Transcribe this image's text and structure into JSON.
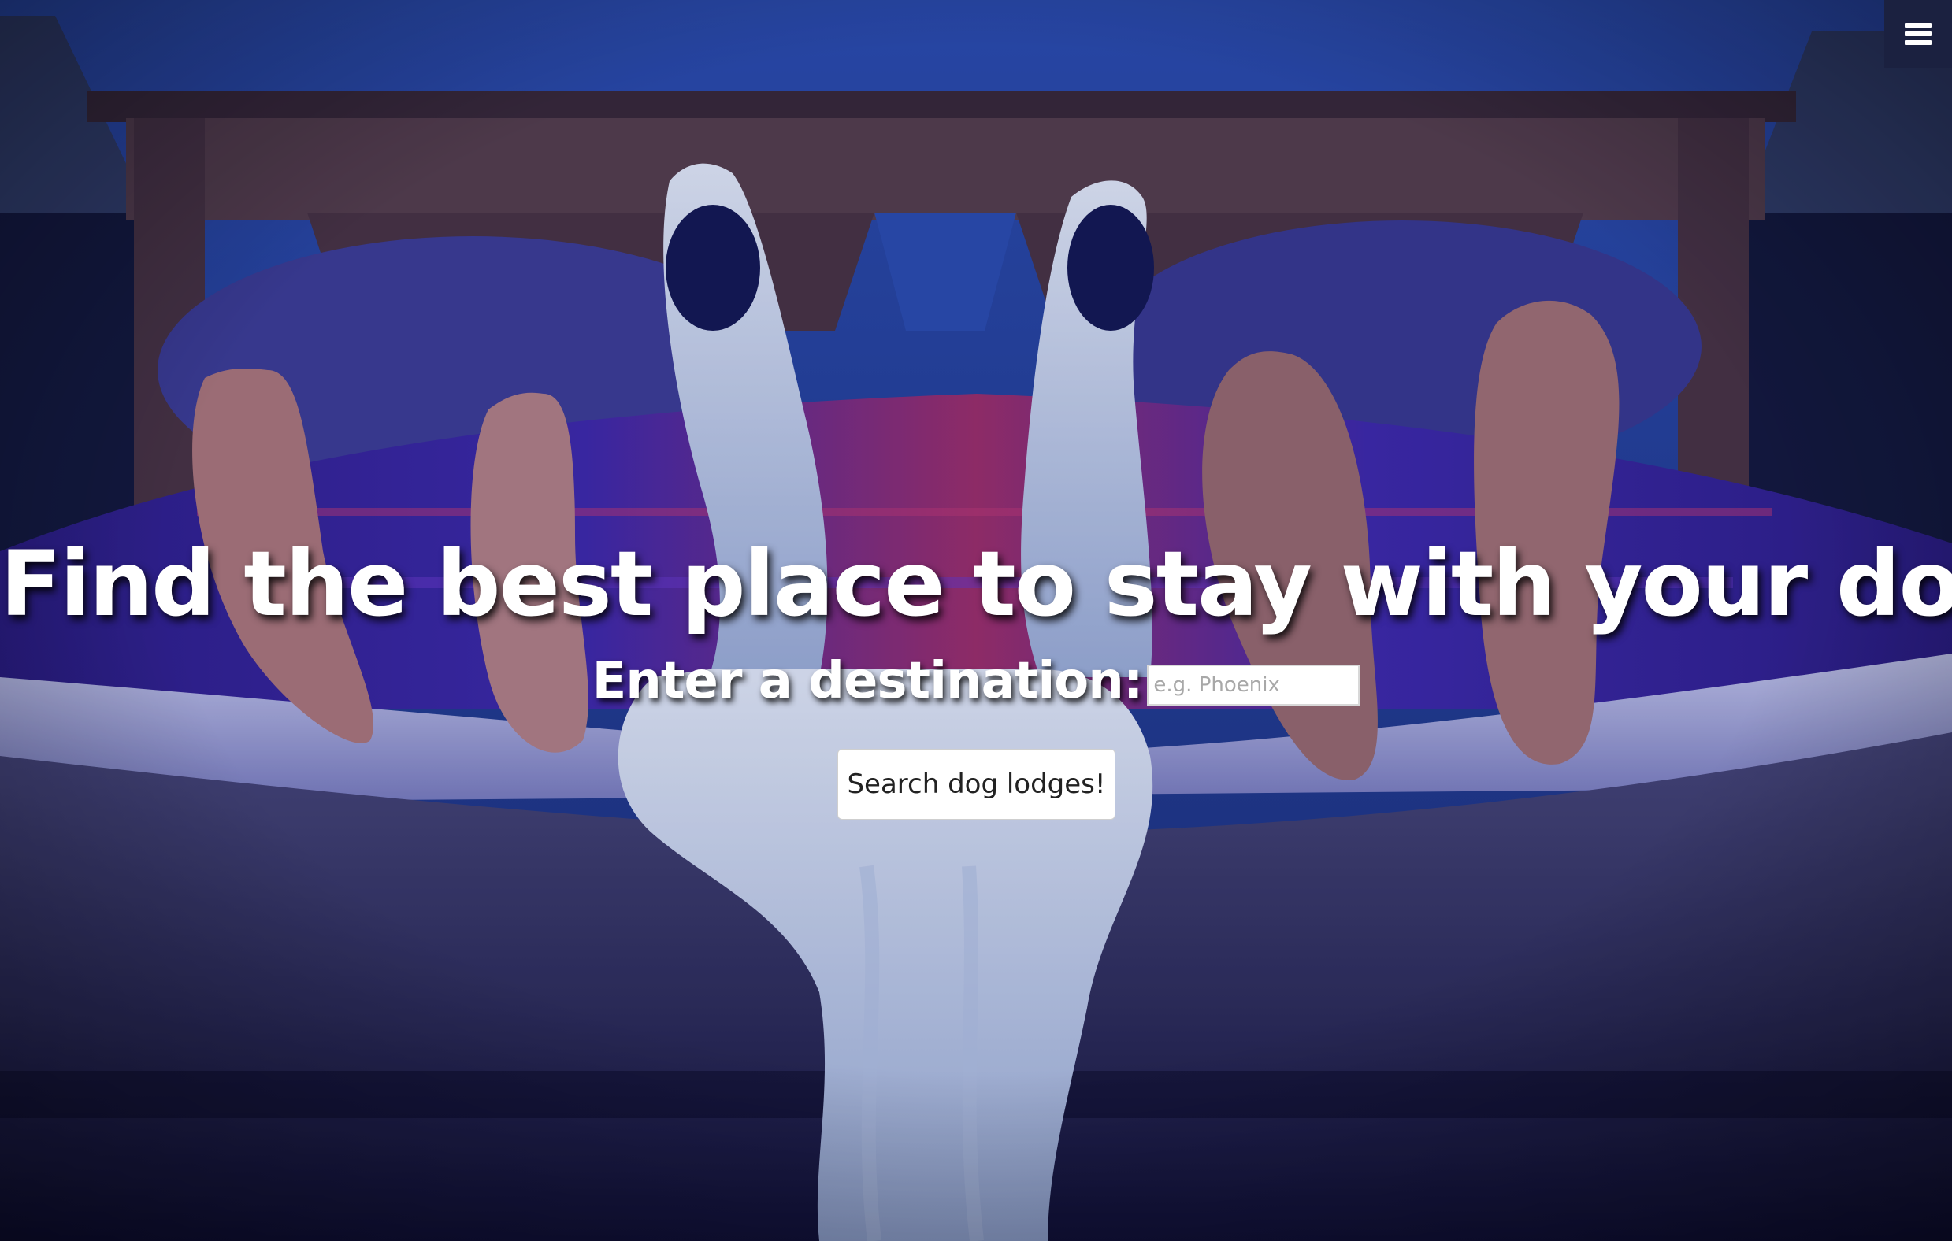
{
  "header": {
    "menu_icon": "hamburger-menu-icon",
    "menu_bg_color": "#1b2140"
  },
  "hero": {
    "image": "bed-with-human-feet-and-dog-legs-photo",
    "headline": "Find the best place to stay with your dog!"
  },
  "search": {
    "label": "Enter a destination:",
    "value": "",
    "placeholder": "e.g. Phoenix",
    "button_label": "Search dog lodges!"
  }
}
